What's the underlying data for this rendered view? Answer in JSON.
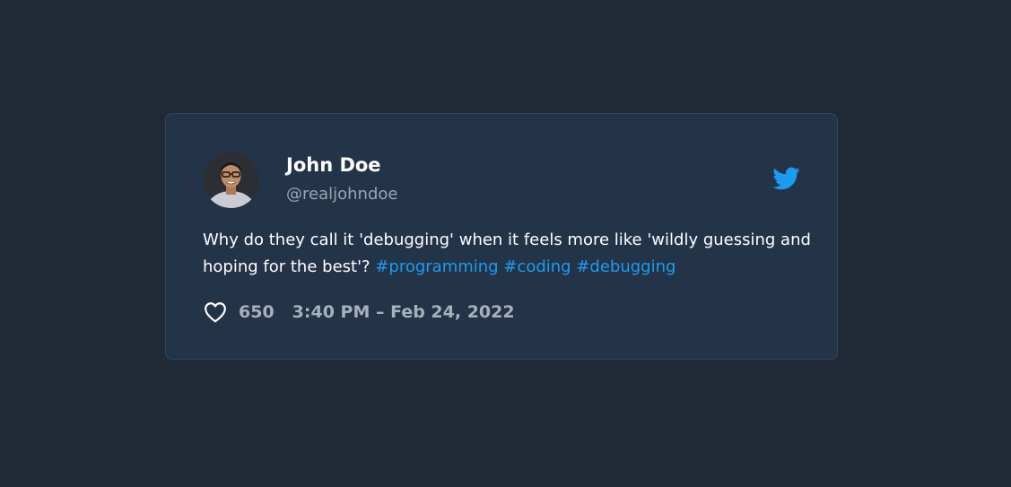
{
  "tweet": {
    "author": {
      "name": "John Doe",
      "handle": "@realjohndoe",
      "avatar_icon": "user-avatar-photo"
    },
    "brand_icon": "twitter-bird-icon",
    "text": "Why do they call it 'debugging' when it feels more like 'wildly guessing and hoping for the best'?",
    "hashtags": [
      "#programming",
      "#coding",
      "#debugging"
    ],
    "likes": "650",
    "timestamp": "3:40 PM – Feb 24, 2022",
    "like_icon": "heart-outline-icon"
  },
  "colors": {
    "page_background": "#212836",
    "card_background": "#243448",
    "card_border": "#2f4660",
    "accent": "#1d9bf0",
    "text_primary": "#ffffff",
    "text_muted": "#a7b0bd"
  }
}
